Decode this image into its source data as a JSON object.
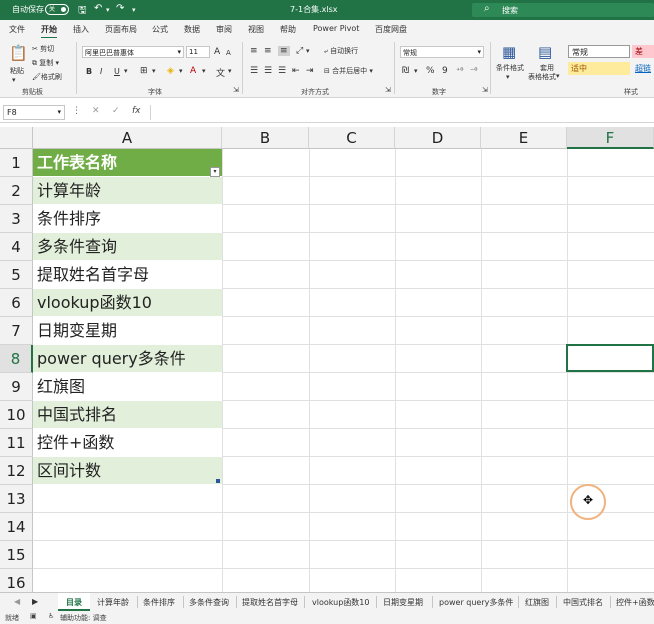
{
  "titlebar": {
    "autosave_label": "自动保存",
    "toggle_state": "关",
    "doc_title": "7-1合集.xlsx",
    "search_placeholder": "搜索"
  },
  "menu_tabs": [
    "文件",
    "开始",
    "插入",
    "页面布局",
    "公式",
    "数据",
    "审阅",
    "视图",
    "帮助",
    "Power Pivot",
    "百度网盘"
  ],
  "ribbon": {
    "clipboard": {
      "paste": "粘贴",
      "cut": "剪切",
      "copy": "复制",
      "format_painter": "格式刷",
      "group": "剪贴板"
    },
    "font": {
      "name": "阿里巴巴普惠体",
      "size": "11",
      "bold": "B",
      "italic": "I",
      "underline": "U",
      "grow": "A",
      "shrink": "A",
      "group": "字体"
    },
    "alignment": {
      "wrap": "自动换行",
      "merge": "合并后居中",
      "group": "对齐方式"
    },
    "number": {
      "format": "常规",
      "percent": "%",
      "comma": "9",
      "group": "数字"
    },
    "styles": {
      "conditional": "条件格式",
      "table_l1": "套用",
      "table_l2": "表格格式",
      "normal": "常规",
      "bad": "差",
      "neutral": "适中",
      "hyperlink": "超链",
      "group": "样式"
    }
  },
  "formula_bar": {
    "name_box": "F8",
    "fx": "fx",
    "cancel": "✕",
    "enter": "✓",
    "value": ""
  },
  "columns": [
    "A",
    "B",
    "C",
    "D",
    "E",
    "F"
  ],
  "rows": [
    "1",
    "2",
    "3",
    "4",
    "5",
    "6",
    "7",
    "8",
    "9",
    "10",
    "11",
    "12",
    "13",
    "14",
    "15",
    "16"
  ],
  "cells_A": [
    "工作表名称",
    "计算年龄",
    "条件排序",
    "多条件查询",
    "提取姓名首字母",
    "vlookup函数10",
    "日期变星期",
    "power query多条件",
    "红旗图",
    "中国式排名",
    "控件+函数",
    "区间计数"
  ],
  "sheet_tabs": [
    "目录",
    "计算年龄",
    "条件排序",
    "多条件查询",
    "提取姓名首字母",
    "vlookup函数10",
    "日期变星期",
    "power query多条件",
    "红旗图",
    "中国式排名",
    "控件+函数"
  ],
  "statusbar": {
    "ready": "就绪",
    "accessibility": "辅助功能: 调查"
  },
  "colors": {
    "accent": "#217346",
    "header_fill": "#70ad47",
    "band_fill": "#e2efda"
  }
}
